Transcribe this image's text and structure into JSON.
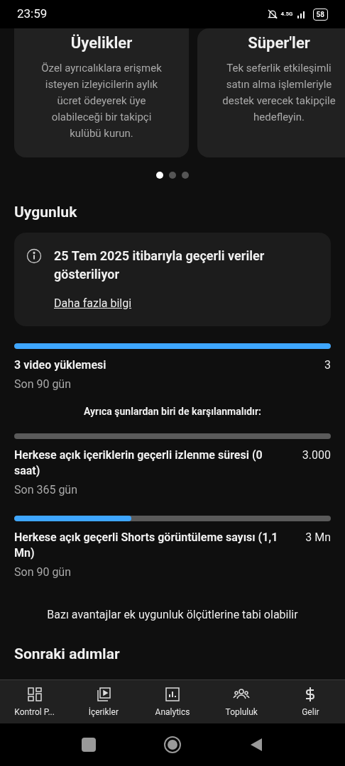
{
  "status_bar": {
    "time": "23:59",
    "battery": "58",
    "network": "4.5G"
  },
  "cards": [
    {
      "title": "Üyelikler",
      "lines": [
        "Özel ayrıcalıklara erişmek",
        "isteyen izleyicilerin aylık",
        "ücret ödeyerek üye",
        "olabileceği bir takipçi",
        "kulübü kurun."
      ]
    },
    {
      "title": "Süper'ler",
      "lines": [
        "Tek seferlik etkileşimli",
        "satın alma işlemleriyle",
        "destek verecek takipçile",
        "hedefleyin."
      ]
    }
  ],
  "carousel_dots": [
    {
      "selected": true
    },
    {
      "selected": false
    },
    {
      "selected": false
    }
  ],
  "eligibility": {
    "heading": "Uygunluk",
    "info": "25 Tem 2025 itibarıyla geçerli veriler gösteriliyor",
    "link": "Daha fazla bilgi",
    "requirements": [
      {
        "level": 1,
        "label": "3 video yüklemesi",
        "target": "3",
        "period": "Son 90 gün"
      }
    ],
    "also_text": "Ayrıca şunlardan biri de karşılanmalıdır:",
    "alternatives": [
      {
        "level": 0,
        "label": "Herkese açık içeriklerin geçerli izlenme süresi (0 saat)",
        "target": "3.000",
        "period": "Son 365 gün"
      },
      {
        "level": 0.37,
        "label": "Herkese açık geçerli Shorts görüntüleme sayısı (1,1 Mn)",
        "target": "3 Mn",
        "period": "Son 90 gün"
      }
    ],
    "note": "Bazı avantajlar ek uygunluk ölçütlerine tabi olabilir"
  },
  "next_heading": "Sonraki adımlar",
  "bottom_nav": [
    {
      "kind": "dashboard",
      "label": "Kontrol P..."
    },
    {
      "kind": "content",
      "label": "İçerikler"
    },
    {
      "kind": "analytics",
      "label": "Analytics"
    },
    {
      "kind": "community",
      "label": "Topluluk"
    },
    {
      "kind": "earn",
      "label": "Gelir"
    }
  ]
}
